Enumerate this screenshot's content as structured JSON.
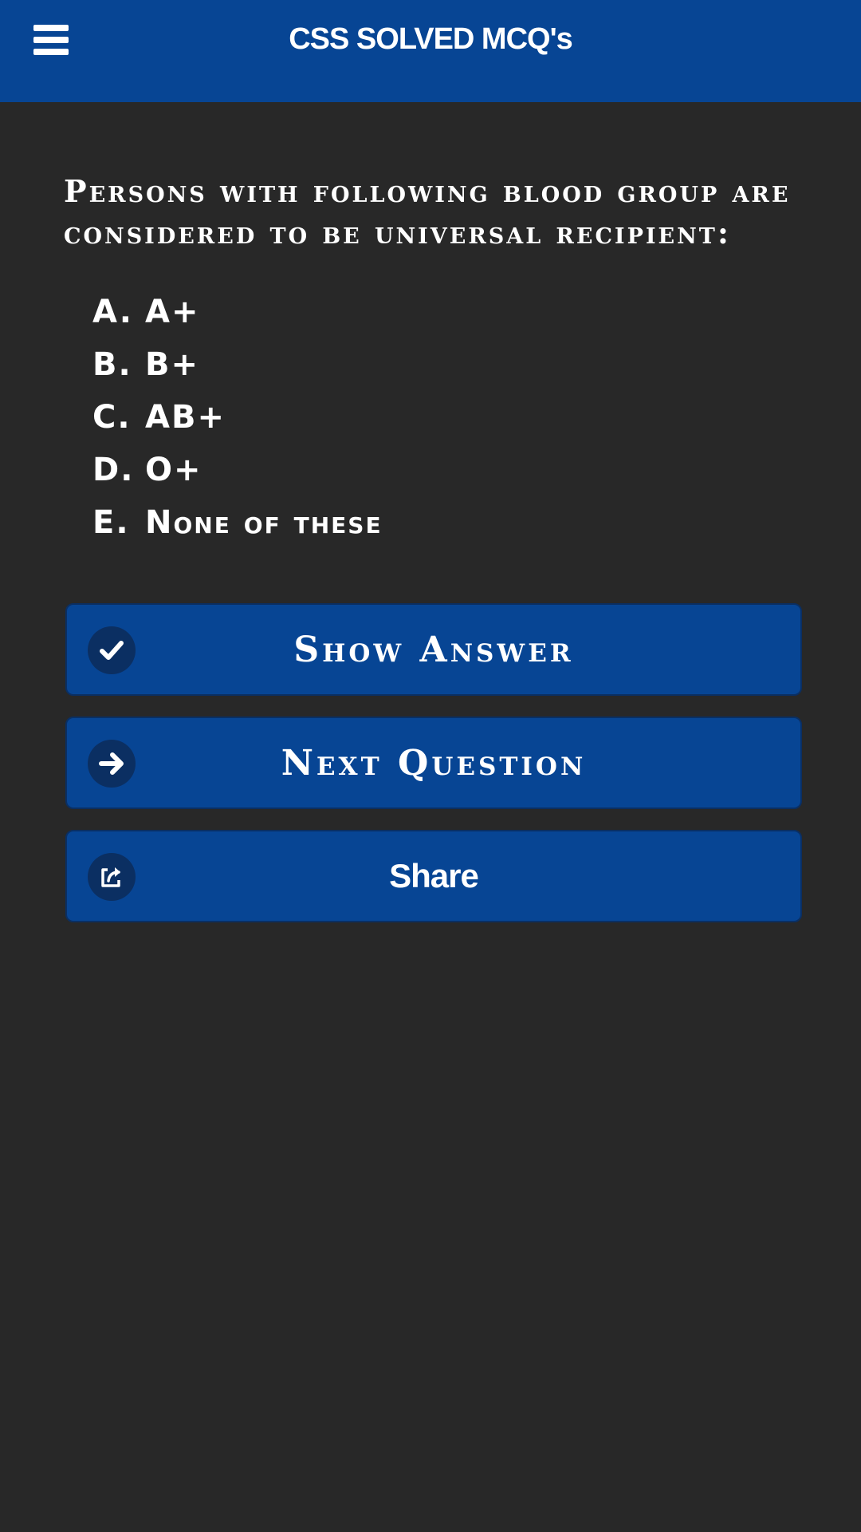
{
  "header": {
    "title": "CSS SOLVED MCQ's",
    "menu_icon": "hamburger-menu-icon",
    "background": "#074594"
  },
  "question": {
    "text": "Persons with following blood group are considered to be universal recipient:",
    "options": [
      {
        "letter": "A.",
        "text": "A+"
      },
      {
        "letter": "B.",
        "text": "B+"
      },
      {
        "letter": "C.",
        "text": "AB+"
      },
      {
        "letter": "D.",
        "text": "O+"
      },
      {
        "letter": "E.",
        "text": "None of these"
      }
    ]
  },
  "buttons": {
    "show_answer": {
      "label": "Show Answer",
      "icon": "check-icon"
    },
    "next_question": {
      "label": "Next Question",
      "icon": "arrow-right-icon"
    },
    "share": {
      "label": "Share",
      "icon": "share-icon"
    }
  },
  "colors": {
    "background": "#282828",
    "accent": "#074594",
    "icon_circle": "#0b2f62",
    "text": "#ffffff"
  }
}
